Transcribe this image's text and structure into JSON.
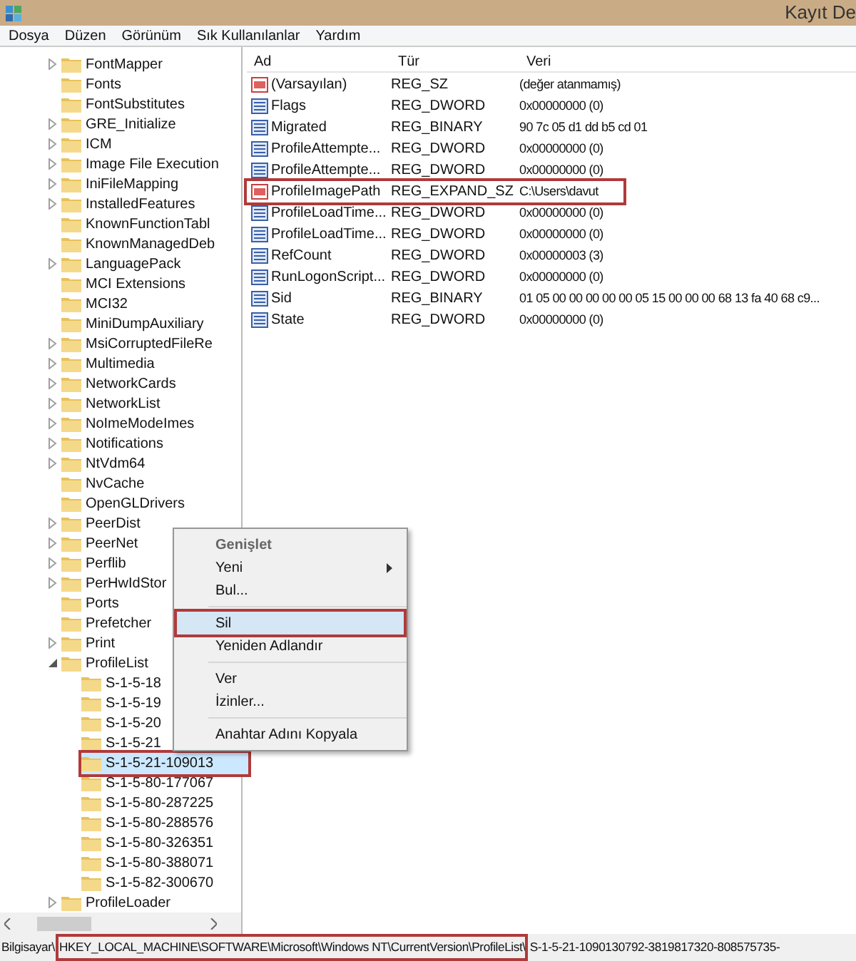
{
  "window": {
    "title": "Kayıt De"
  },
  "menu": [
    "Dosya",
    "Düzen",
    "Görünüm",
    "Sık Kullanılanlar",
    "Yardım"
  ],
  "tree": [
    {
      "label": "FontMapper",
      "expanded": false,
      "selected": false
    },
    {
      "label": "Fonts",
      "selected": false
    },
    {
      "label": "FontSubstitutes",
      "selected": false
    },
    {
      "label": "GRE_Initialize",
      "expanded": false,
      "selected": false
    },
    {
      "label": "ICM",
      "expanded": false,
      "selected": false
    },
    {
      "label": "Image File Execution",
      "expanded": false,
      "selected": false
    },
    {
      "label": "IniFileMapping",
      "expanded": false,
      "selected": false
    },
    {
      "label": "InstalledFeatures",
      "expanded": false,
      "selected": false
    },
    {
      "label": "KnownFunctionTabl",
      "selected": false
    },
    {
      "label": "KnownManagedDeb",
      "selected": false
    },
    {
      "label": "LanguagePack",
      "expanded": false,
      "selected": false
    },
    {
      "label": "MCI Extensions",
      "selected": false
    },
    {
      "label": "MCI32",
      "selected": false
    },
    {
      "label": "MiniDumpAuxiliary",
      "selected": false
    },
    {
      "label": "MsiCorruptedFileRe",
      "expanded": false,
      "selected": false
    },
    {
      "label": "Multimedia",
      "expanded": false,
      "selected": false
    },
    {
      "label": "NetworkCards",
      "expanded": false,
      "selected": false
    },
    {
      "label": "NetworkList",
      "expanded": false,
      "selected": false
    },
    {
      "label": "NoImeModeImes",
      "expanded": false,
      "selected": false
    },
    {
      "label": "Notifications",
      "expanded": false,
      "selected": false
    },
    {
      "label": "NtVdm64",
      "expanded": false,
      "selected": false
    },
    {
      "label": "NvCache",
      "selected": false
    },
    {
      "label": "OpenGLDrivers",
      "selected": false
    },
    {
      "label": "PeerDist",
      "expanded": false,
      "selected": false
    },
    {
      "label": "PeerNet",
      "expanded": false,
      "selected": false
    },
    {
      "label": "Perflib",
      "expanded": false,
      "selected": false
    },
    {
      "label": "PerHwIdStor",
      "expanded": false,
      "selected": false
    },
    {
      "label": "Ports",
      "selected": false
    },
    {
      "label": "Prefetcher",
      "selected": false
    },
    {
      "label": "Print",
      "expanded": false,
      "selected": false
    },
    {
      "label": "ProfileList",
      "expanded": true,
      "selected": false,
      "children": [
        {
          "label": "S-1-5-18",
          "selected": false
        },
        {
          "label": "S-1-5-19",
          "selected": false
        },
        {
          "label": "S-1-5-20",
          "selected": false
        },
        {
          "label": "S-1-5-21",
          "selected": false
        },
        {
          "label": "S-1-5-21-109013",
          "selected": true,
          "annotated": true
        },
        {
          "label": "S-1-5-80-177067",
          "selected": false
        },
        {
          "label": "S-1-5-80-287225",
          "selected": false
        },
        {
          "label": "S-1-5-80-288576",
          "selected": false
        },
        {
          "label": "S-1-5-80-326351",
          "selected": false
        },
        {
          "label": "S-1-5-80-388071",
          "selected": false
        },
        {
          "label": "S-1-5-82-300670",
          "selected": false
        }
      ]
    },
    {
      "label": "ProfileLoader",
      "expanded": false,
      "selected": false
    }
  ],
  "values": {
    "columns": [
      "Ad",
      "Tür",
      "Veri"
    ],
    "rows": [
      {
        "kind": "string",
        "name": "(Varsayılan)",
        "type": "REG_SZ",
        "data": "(değer atanmamış)",
        "annotated": false
      },
      {
        "kind": "binary",
        "name": "Flags",
        "type": "REG_DWORD",
        "data": "0x00000000 (0)",
        "annotated": false
      },
      {
        "kind": "binary",
        "name": "Migrated",
        "type": "REG_BINARY",
        "data": "90 7c 05 d1 dd b5 cd 01",
        "annotated": false
      },
      {
        "kind": "binary",
        "name": "ProfileAttempte...",
        "type": "REG_DWORD",
        "data": "0x00000000 (0)",
        "annotated": false
      },
      {
        "kind": "binary",
        "name": "ProfileAttempte...",
        "type": "REG_DWORD",
        "data": "0x00000000 (0)",
        "annotated": false
      },
      {
        "kind": "string",
        "name": "ProfileImagePath",
        "type": "REG_EXPAND_SZ",
        "data": "C:\\Users\\davut",
        "annotated": true
      },
      {
        "kind": "binary",
        "name": "ProfileLoadTime...",
        "type": "REG_DWORD",
        "data": "0x00000000 (0)",
        "annotated": false
      },
      {
        "kind": "binary",
        "name": "ProfileLoadTime...",
        "type": "REG_DWORD",
        "data": "0x00000000 (0)",
        "annotated": false
      },
      {
        "kind": "binary",
        "name": "RefCount",
        "type": "REG_DWORD",
        "data": "0x00000003 (3)",
        "annotated": false
      },
      {
        "kind": "binary",
        "name": "RunLogonScript...",
        "type": "REG_DWORD",
        "data": "0x00000000 (0)",
        "annotated": false
      },
      {
        "kind": "binary",
        "name": "Sid",
        "type": "REG_BINARY",
        "data": "01 05 00 00 00 00 00 05 15 00 00 00 68 13 fa 40 68 c9...",
        "annotated": false
      },
      {
        "kind": "binary",
        "name": "State",
        "type": "REG_DWORD",
        "data": "0x00000000 (0)",
        "annotated": false
      }
    ]
  },
  "context_menu": [
    {
      "kind": "item",
      "label": "Genişlet",
      "bold": true,
      "submenu": false,
      "selected": false
    },
    {
      "kind": "item",
      "label": "Yeni",
      "bold": false,
      "submenu": true,
      "selected": false
    },
    {
      "kind": "item",
      "label": "Bul...",
      "bold": false,
      "submenu": false,
      "selected": false
    },
    {
      "kind": "separator"
    },
    {
      "kind": "item",
      "label": "Sil",
      "bold": false,
      "submenu": false,
      "selected": true
    },
    {
      "kind": "item",
      "label": "Yeniden Adlandır",
      "bold": false,
      "submenu": false,
      "selected": false
    },
    {
      "kind": "separator"
    },
    {
      "kind": "item",
      "label": "Ver",
      "bold": false,
      "submenu": false,
      "selected": false
    },
    {
      "kind": "item",
      "label": "İzinler...",
      "bold": false,
      "submenu": false,
      "selected": false
    },
    {
      "kind": "separator"
    },
    {
      "kind": "item",
      "label": "Anahtar Adını Kopyala",
      "bold": false,
      "submenu": false,
      "selected": false
    }
  ],
  "status_bar": [
    {
      "text": "Bilgisayar\\",
      "annotated": false
    },
    {
      "text": "HKEY_LOCAL_MACHINE\\SOFTWARE\\Microsoft\\Windows NT\\CurrentVersion\\ProfileList\\",
      "annotated": true
    },
    {
      "text": "S-1-5-21-1090130792-3819817320-808575735-",
      "annotated": false
    }
  ]
}
